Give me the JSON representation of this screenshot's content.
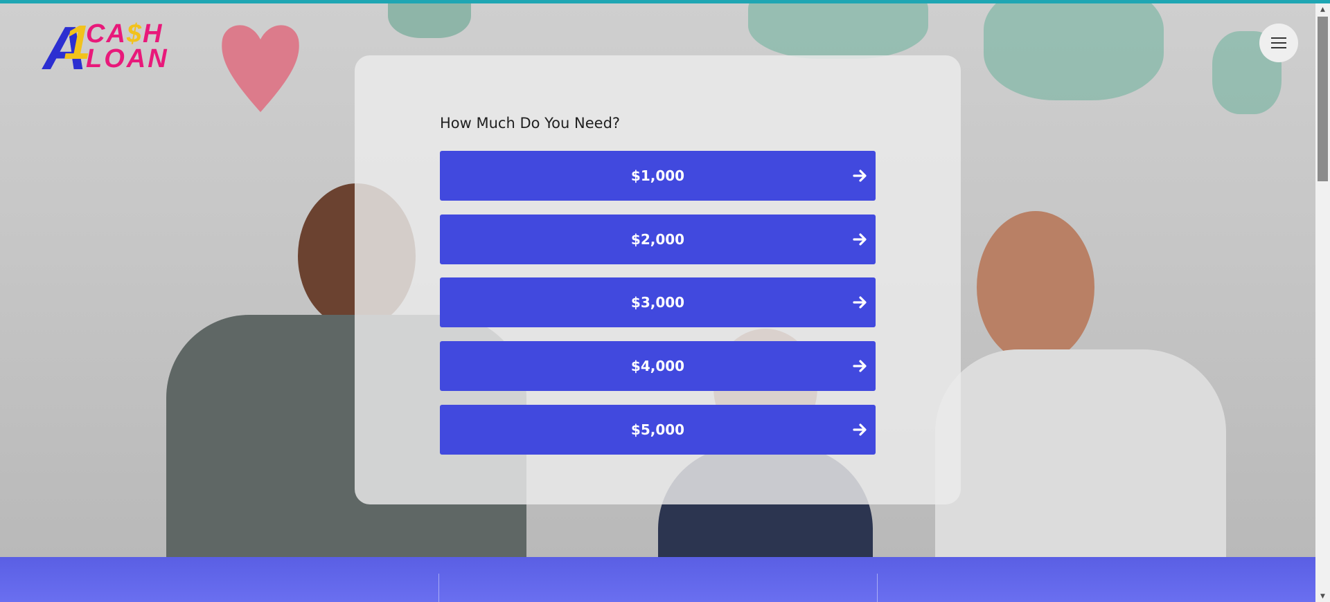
{
  "brand": {
    "logo_a": "A",
    "logo_one": "1",
    "logo_cash_c": "C",
    "logo_cash_a": "A",
    "logo_cash_dollar": "$",
    "logo_cash_h": "H",
    "logo_loan": "LOAN",
    "accent_color": "#4149de",
    "logo_pink": "#e8197a",
    "logo_yellow": "#f2c21b",
    "logo_blue": "#2c2fd1"
  },
  "header": {
    "menu_icon": "hamburger-menu-icon"
  },
  "loan_form": {
    "question": "How Much Do You Need?",
    "options": [
      {
        "label": "$1,000",
        "icon": "arrow-right-icon"
      },
      {
        "label": "$2,000",
        "icon": "arrow-right-icon"
      },
      {
        "label": "$3,000",
        "icon": "arrow-right-icon"
      },
      {
        "label": "$4,000",
        "icon": "arrow-right-icon"
      },
      {
        "label": "$5,000",
        "icon": "arrow-right-icon"
      }
    ]
  },
  "colors": {
    "top_strip": "#1fa6b3",
    "footer_band": "#5a5fe4",
    "card_background": "#ebebeb"
  }
}
